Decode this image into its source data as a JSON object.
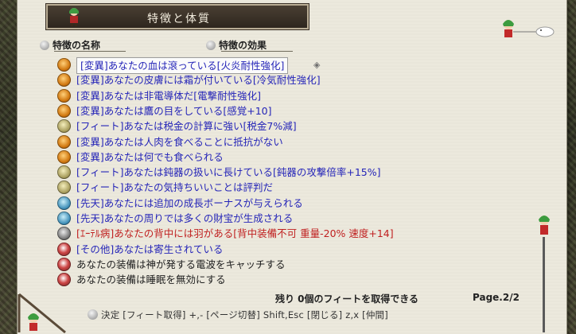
{
  "window": {
    "title": "特徴と体質"
  },
  "columns": {
    "name_header": "特徴の名称",
    "effect_header": "特徴の効果"
  },
  "traits": [
    {
      "text": "[変異]あなたの血は滾っている[火炎耐性強化]",
      "category": "mutation",
      "icon": "mutation-icon",
      "color": "blue",
      "selected": true
    },
    {
      "text": "[変異]あなたの皮膚には霜が付いている[冷気耐性強化]",
      "category": "mutation",
      "icon": "mutation-icon",
      "color": "blue"
    },
    {
      "text": "[変異]あなたは非電導体だ[電撃耐性強化]",
      "category": "mutation",
      "icon": "mutation-icon",
      "color": "blue"
    },
    {
      "text": "[変異]あなたは鷹の目をしている[感覚+10]",
      "category": "mutation",
      "icon": "mutation-icon",
      "color": "blue"
    },
    {
      "text": "[フィート]あなたは税金の計算に強い[税金7%減]",
      "category": "feat",
      "icon": "feat-icon",
      "color": "blue"
    },
    {
      "text": "[変異]あなたは人肉を食べることに抵抗がない",
      "category": "mutation",
      "icon": "mutation-icon",
      "color": "blue"
    },
    {
      "text": "[変異]あなたは何でも食べられる",
      "category": "mutation",
      "icon": "mutation-icon",
      "color": "blue"
    },
    {
      "text": "[フィート]あなたは鈍器の扱いに長けている[鈍器の攻撃倍率+15%]",
      "category": "feat",
      "icon": "feat-icon",
      "color": "blue"
    },
    {
      "text": "[フィート]あなたの気持ちいいことは評判だ",
      "category": "feat",
      "icon": "feat-icon",
      "color": "blue"
    },
    {
      "text": "[先天]あなたには追加の成長ボーナスが与えられる",
      "category": "innate",
      "icon": "innate-icon",
      "color": "blue"
    },
    {
      "text": "[先天]あなたの周りでは多くの財宝が生成される",
      "category": "innate",
      "icon": "innate-icon",
      "color": "blue"
    },
    {
      "text": "[ｴｰﾃﾙ病]あなたの背中には羽がある[背中装備不可 重量-20% 速度+14]",
      "category": "ether",
      "icon": "ether-disease-icon",
      "color": "red"
    },
    {
      "text": "[その他]あなたは寄生されている",
      "category": "other",
      "icon": "other-icon",
      "color": "blue"
    },
    {
      "text": "あなたの装備は神が発する電波をキャッチする",
      "category": "equipment",
      "icon": "equipment-icon",
      "color": "dark"
    },
    {
      "text": "あなたの装備は睡眠を無効にする",
      "category": "equipment",
      "icon": "equipment-icon",
      "color": "dark"
    }
  ],
  "footer": {
    "feats_remaining": "残り 0個のフィートを取得できる",
    "page": "Page.2/2",
    "keys": "決定 [フィート取得]  +,- [ページ切替]  Shift,Esc [閉じる]  z,x [仲間]"
  }
}
